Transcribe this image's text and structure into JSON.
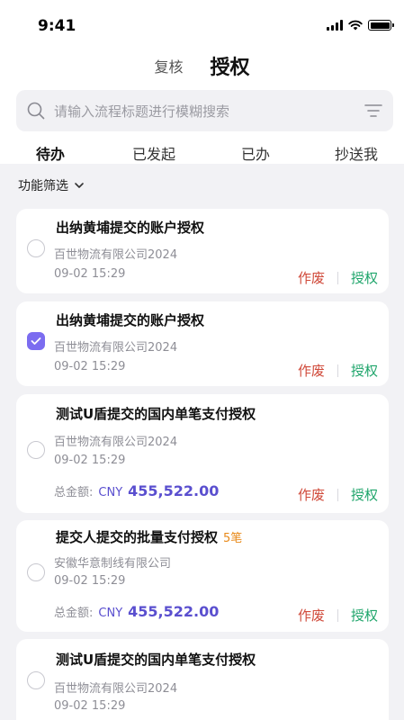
{
  "status": {
    "time": "9:41"
  },
  "nav": {
    "tab_review": "复核",
    "tab_authorize": "授权"
  },
  "search": {
    "placeholder": "请输入流程标题进行模糊搜索"
  },
  "tabs": [
    "待办",
    "已发起",
    "已办",
    "抄送我"
  ],
  "filter": {
    "label": "功能筛选"
  },
  "amount_label": "总金额:",
  "actions": {
    "void": "作废",
    "authorize": "授权"
  },
  "cards": [
    {
      "title": "出纳黄埔提交的账户授权",
      "company": "百世物流有限公司2024",
      "time": "09-02 15:29",
      "checked": false
    },
    {
      "title": "出纳黄埔提交的账户授权",
      "company": "百世物流有限公司2024",
      "time": "09-02 15:29",
      "checked": true
    },
    {
      "title": "测试U盾提交的国内单笔支付授权",
      "company": "百世物流有限公司2024",
      "time": "09-02 15:29",
      "currency": "CNY",
      "amount": "455,522.00",
      "checked": false
    },
    {
      "title": "提交人提交的批量支付授权",
      "badge": "5笔",
      "company": "安徽华意制线有限公司",
      "time": "09-02 15:29",
      "currency": "CNY",
      "amount": "455,522.00",
      "checked": false
    },
    {
      "title": "测试U盾提交的国内单笔支付授权",
      "company": "百世物流有限公司2024",
      "time": "09-02 15:29",
      "checked": false
    }
  ]
}
